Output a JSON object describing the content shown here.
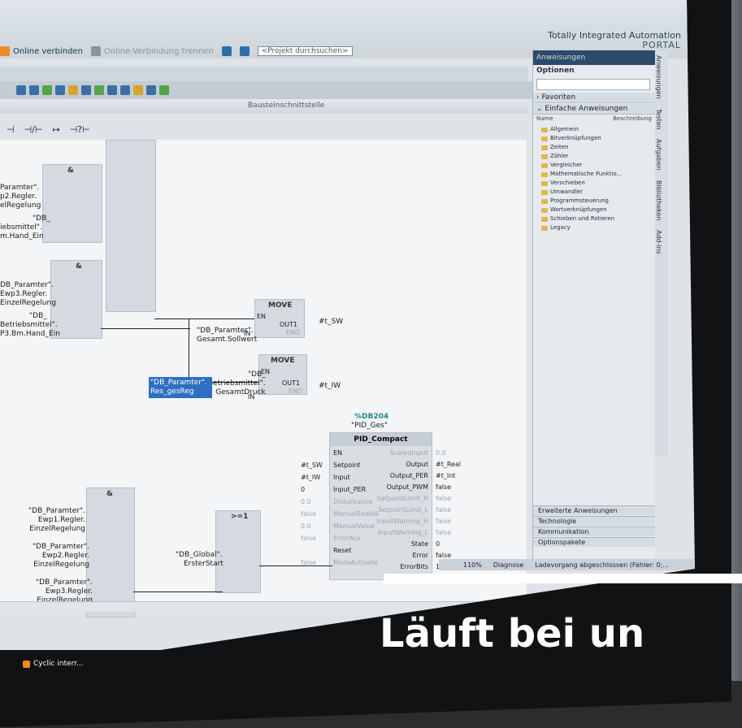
{
  "topbar": {
    "brand_line1": "Totally Integrated Automation",
    "brand_line2": "PORTAL",
    "online_connect": "Online verbinden",
    "online_disconnect": "Online-Verbindung trennen",
    "search_placeholder": "<Projekt durchsuchen>"
  },
  "editor": {
    "title_strip": "Bausteinschnittstelle",
    "zoom": "110%"
  },
  "ladder_symbols": [
    "⊣",
    "⊣/⊢",
    "↦",
    "⊣?⊢"
  ],
  "network_blocks": {
    "and_top": "&",
    "and_mid": "&",
    "and_bottom": "&",
    "or_block": ">=1",
    "move1": "MOVE",
    "move2": "MOVE",
    "en": "EN",
    "out1": "OUT1",
    "eno": "ENO",
    "in": "IN"
  },
  "labels": {
    "top1": [
      "Paramter\".",
      "p2.Regler.",
      "elRegelung"
    ],
    "top2": [
      "\"DB_",
      "iebsmittel\".",
      "m.Hand_Ein"
    ],
    "mid1": [
      "DB_Paramter\".",
      "Ewp3.Regler.",
      "EinzelRegelung"
    ],
    "mid2": [
      "\"DB_",
      "Betriebsmittel\".",
      "P3.Bm.Hand_Ein"
    ],
    "move1_in": [
      "\"DB_Paramter\".",
      "Gesamt.Sollwert"
    ],
    "move1_out": "#t_SW",
    "move2_in": [
      "\"DB_",
      "Betriebsmittel\".",
      "GesamtDruck"
    ],
    "move2_out": "#t_IW",
    "bot1": [
      "\"DB_Paramter\".",
      "Ewp1.Regler.",
      "EinzelRegelung"
    ],
    "bot2": [
      "\"DB_Paramter\".",
      "Ewp2.Regler.",
      "EinzelRegelung"
    ],
    "bot3": [
      "\"DB_Paramter\".",
      "Ewp3.Regler.",
      "EinzelRegelung"
    ],
    "selected": [
      "\"DB_Paramter\".",
      "Res_gesReg"
    ],
    "global": [
      "\"DB_Global\".",
      "ErsterStart"
    ]
  },
  "pid": {
    "db": "%DB204",
    "instance": "\"PID_Ges\"",
    "name": "PID_Compact",
    "inputs": [
      {
        "label": "EN",
        "value": "",
        "dim": false
      },
      {
        "label": "Setpoint",
        "value": "#t_SW",
        "dim": false
      },
      {
        "label": "Input",
        "value": "#t_IW",
        "dim": false
      },
      {
        "label": "Input_PER",
        "value": "0",
        "dim": false
      },
      {
        "label": "Disturbance",
        "value": "0.0",
        "dim": true
      },
      {
        "label": "ManualEnable",
        "value": "false",
        "dim": true
      },
      {
        "label": "ManualValue",
        "value": "0.0",
        "dim": true
      },
      {
        "label": "ErrorAck",
        "value": "false",
        "dim": true
      },
      {
        "label": "Reset",
        "value": "",
        "dim": false
      },
      {
        "label": "ModeActivate",
        "value": "false",
        "dim": true
      }
    ],
    "outputs": [
      {
        "label": "ScaledInput",
        "value": "0.0",
        "dim": true
      },
      {
        "label": "Output",
        "value": "#t_Real",
        "dim": false
      },
      {
        "label": "Output_PER",
        "value": "#t_Int",
        "dim": false
      },
      {
        "label": "Output_PWM",
        "value": "false",
        "dim": false
      },
      {
        "label": "SetpointLimit_H",
        "value": "false",
        "dim": true
      },
      {
        "label": "SetpointLimit_L",
        "value": "false",
        "dim": true
      },
      {
        "label": "InputWarning_H",
        "value": "false",
        "dim": true
      },
      {
        "label": "InputWarning_L",
        "value": "false",
        "dim": true
      },
      {
        "label": "State",
        "value": "0",
        "dim": false
      },
      {
        "label": "Error",
        "value": "false",
        "dim": false
      },
      {
        "label": "ErrorBits",
        "value": "16#0",
        "dim": false
      }
    ]
  },
  "right_panel": {
    "title": "Anweisungen",
    "options": "Optionen",
    "favoriten": "Favoriten",
    "einfache": "Einfache Anweisungen",
    "col_name": "Name",
    "col_desc": "Beschreibung",
    "items": [
      "Allgemein",
      "Bitverknüpfungen",
      "Zeiten",
      "Zähler",
      "Vergleicher",
      "Mathematische Funktio...",
      "Verschieben",
      "Umwandler",
      "Programmsteuerung",
      "Wortverknüpfungen",
      "Schieben und Rotieren",
      "Legacy"
    ],
    "bottom": [
      "Erweiterte Anweisungen",
      "Technologie",
      "Kommunikation",
      "Optionspakete"
    ]
  },
  "side_tabs": [
    "Anweisungen",
    "Testen",
    "Aufgaben",
    "Bibliotheken",
    "Add-ins"
  ],
  "status": {
    "diagnose": "Diagnose",
    "message": "Ladevorgang abgeschlossen (Fehler: 0;..."
  },
  "taskbar": {
    "item": "Cyclic interr..."
  },
  "headline": "Läuft bei un"
}
